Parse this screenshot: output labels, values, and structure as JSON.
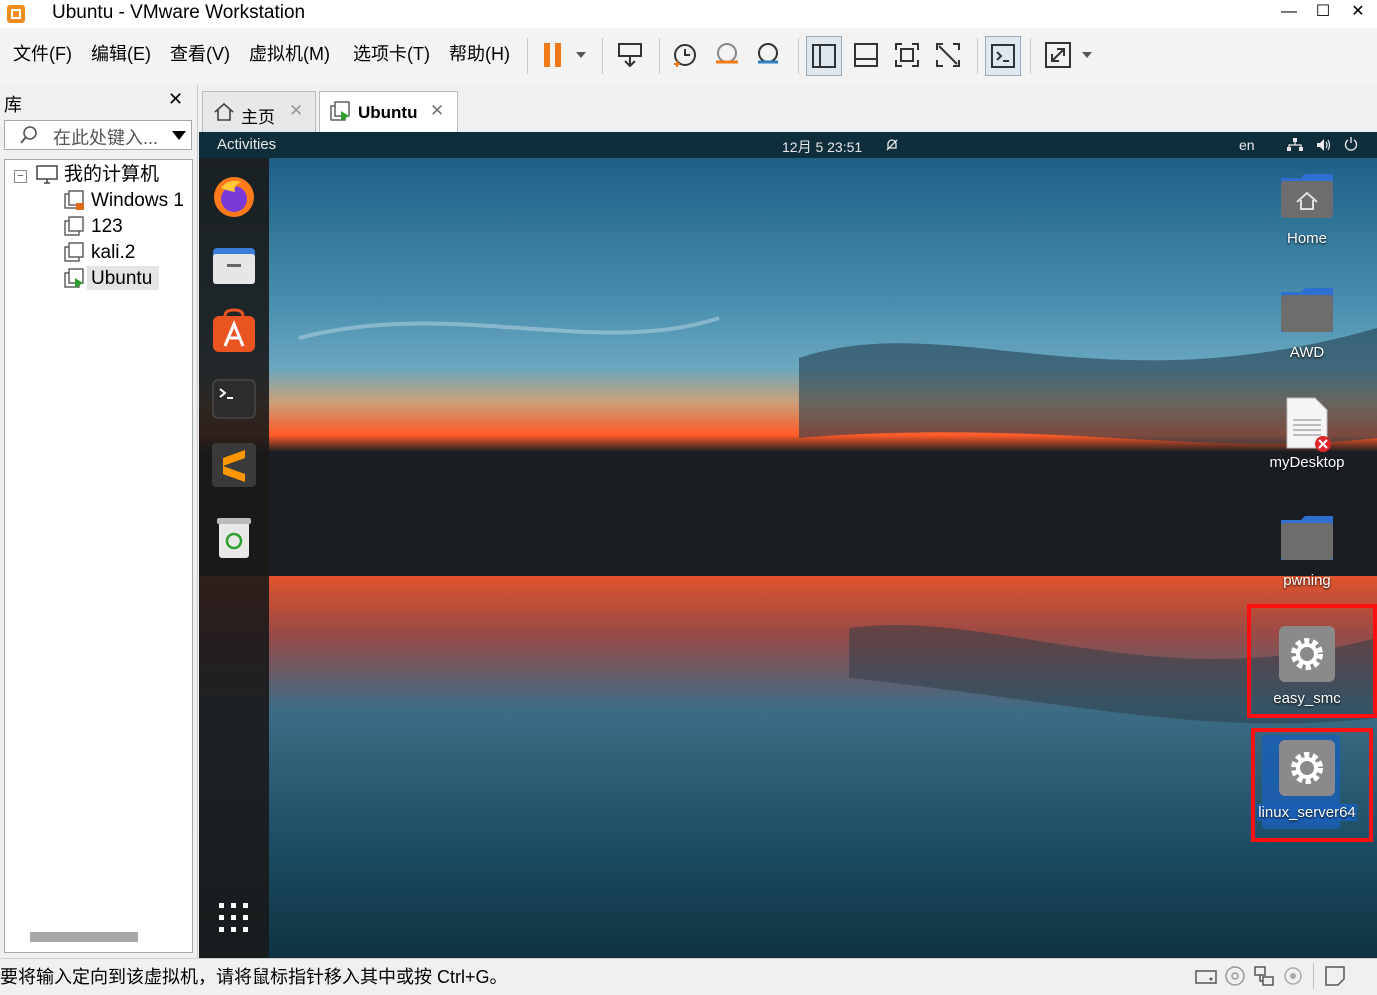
{
  "window": {
    "title": "Ubuntu - VMware Workstation",
    "minimize": "—",
    "maximize": "☐",
    "close": "✕"
  },
  "menu": [
    "文件(F)",
    "编辑(E)",
    "查看(V)",
    "虚拟机(M)",
    "选项卡(T)",
    "帮助(H)"
  ],
  "library": {
    "title": "库",
    "close": "✕",
    "search_placeholder": "在此处键入...",
    "tree": {
      "root": "我的计算机",
      "items": [
        "Windows 1",
        "123",
        "kali.2",
        "Ubuntu"
      ]
    }
  },
  "tabs": [
    {
      "label": "主页",
      "close": "✕"
    },
    {
      "label": "Ubuntu",
      "close": "✕"
    }
  ],
  "guest": {
    "activities": "Activities",
    "clock": "12月 5  23:51",
    "lang": "en",
    "desktop_icons": [
      "Home",
      "AWD",
      "myDesktop",
      "pwning",
      "easy_smc",
      "linux_server64"
    ]
  },
  "status": {
    "message": "要将输入定向到该虚拟机，请将鼠标指针移入其中或按 Ctrl+G。"
  },
  "colors": {
    "accent": "#ff1010",
    "vm_running": "#2e9e2e",
    "pause": "#f07a1a",
    "ubuntu_topbar": "#0e2e3b"
  }
}
